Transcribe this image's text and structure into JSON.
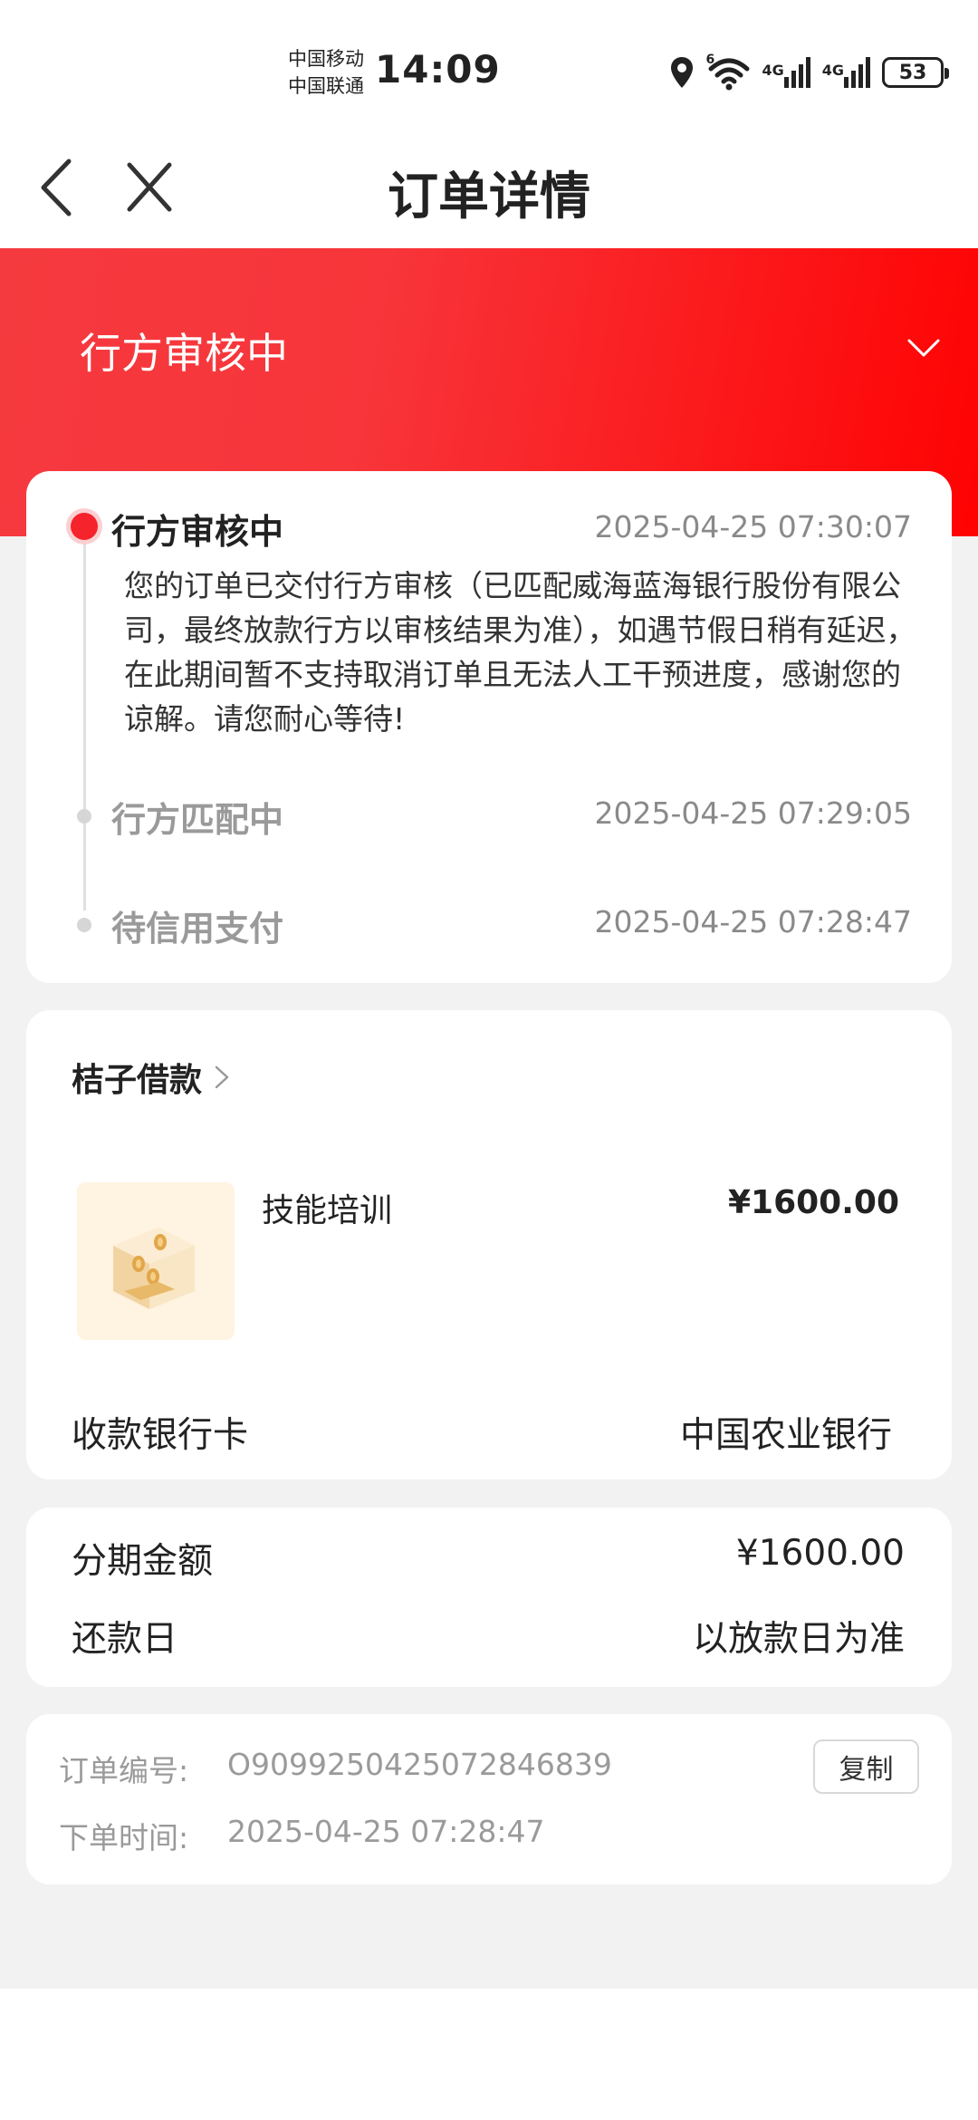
{
  "status_bar": {
    "carrier_1": "中国移动",
    "carrier_2": "中国联通",
    "time": "14:09",
    "wifi_tag": "6",
    "net_1": "4G",
    "net_2": "4G",
    "battery": "53",
    "icons": [
      "location-icon",
      "wifi-icon",
      "signal-icon",
      "signal-icon",
      "battery-icon"
    ]
  },
  "nav": {
    "title": "订单详情",
    "back_icon": "chevron-left-icon",
    "close_icon": "close-icon"
  },
  "banner": {
    "status": "行方审核中",
    "toggle_icon": "chevron-down-icon",
    "colors": {
      "start": "#f53a3f",
      "end": "#ff0202"
    }
  },
  "timeline": [
    {
      "title": "行方审核中",
      "time": "2025-04-25 07:30:07",
      "desc": "您的订单已交付行方审核（已匹配威海蓝海银行股份有限公司，最终放款行方以审核结果为准），如遇节假日稍有延迟，在此期间暂不支持取消订单且无法人工干预进度，感谢您的谅解。请您耐心等待!",
      "active": true
    },
    {
      "title": "行方匹配中",
      "time": "2025-04-25 07:29:05",
      "active": false
    },
    {
      "title": "待信用支付",
      "time": "2025-04-25 07:28:47",
      "active": false
    }
  ],
  "product": {
    "merchant": "桔子借款",
    "merchant_icon": "chevron-right-icon",
    "image_icon": "coin-box-icon",
    "name": "技能培训",
    "price": "¥1600.00",
    "bank_label": "收款银行卡",
    "bank_value": "中国农业银行"
  },
  "installment": {
    "amount_label": "分期金额",
    "amount_value": "¥1600.00",
    "repay_label": "还款日",
    "repay_value": "以放款日为准"
  },
  "order": {
    "no_label": "订单编号:",
    "no_value": "O909925042507284683​9",
    "time_label": "下单时间:",
    "time_value": "2025-04-25 07:28:47",
    "copy_label": "复制"
  },
  "colors": {
    "accent": "#f5232b",
    "background": "#f2f2f2"
  }
}
